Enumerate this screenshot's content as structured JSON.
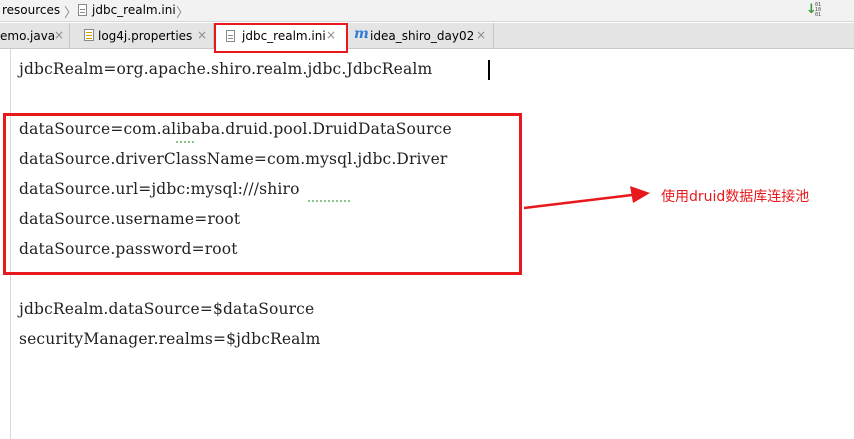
{
  "breadcrumb": {
    "items": [
      "resources",
      "jdbc_realm.ini"
    ]
  },
  "tabs": [
    {
      "label": "emo.java",
      "icon": "java-file-icon",
      "active": false
    },
    {
      "label": "log4j.properties",
      "icon": "properties-file-icon",
      "active": false
    },
    {
      "label": "jdbc_realm.ini",
      "icon": "ini-file-icon",
      "active": true
    },
    {
      "label": "idea_shiro_day02",
      "icon": "maven-m-icon",
      "active": false
    }
  ],
  "editor": {
    "lines": [
      "jdbcRealm=org.apache.shiro.realm.jdbc.JdbcRealm",
      "",
      "dataSource=com.alibaba.druid.pool.DruidDataSource",
      "dataSource.driverClassName=com.mysql.jdbc.Driver",
      "dataSource.url=jdbc:mysql:///shiro",
      "dataSource.username=root",
      "dataSource.password=root",
      "",
      "jdbcRealm.dataSource=$dataSource",
      "securityManager.realms=$jdbcRealm"
    ]
  },
  "annotation": {
    "text": "使用druid数据库连接池",
    "color": "#e8191d"
  }
}
